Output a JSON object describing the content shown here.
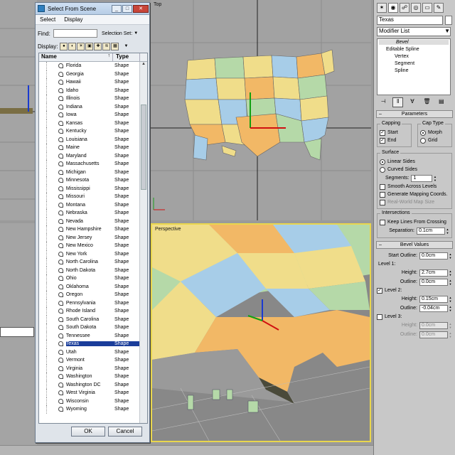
{
  "dialog": {
    "title": "Select From Scene",
    "menus": [
      "Select",
      "Display"
    ],
    "find_label": "Find:",
    "find_value": "",
    "selection_set_label": "Selection Set:",
    "display_label": "Display:",
    "columns": {
      "name": "Name",
      "type": "Type",
      "sort_indicator": "↑"
    },
    "rows": [
      {
        "name": "Florida",
        "type": "Shape"
      },
      {
        "name": "Georgia",
        "type": "Shape"
      },
      {
        "name": "Hawaii",
        "type": "Shape"
      },
      {
        "name": "Idaho",
        "type": "Shape"
      },
      {
        "name": "Illinois",
        "type": "Shape"
      },
      {
        "name": "Indiana",
        "type": "Shape"
      },
      {
        "name": "Iowa",
        "type": "Shape"
      },
      {
        "name": "Kansas",
        "type": "Shape"
      },
      {
        "name": "Kentucky",
        "type": "Shape"
      },
      {
        "name": "Louisiana",
        "type": "Shape"
      },
      {
        "name": "Maine",
        "type": "Shape"
      },
      {
        "name": "Maryland",
        "type": "Shape"
      },
      {
        "name": "Massachusetts",
        "type": "Shape"
      },
      {
        "name": "Michigan",
        "type": "Shape"
      },
      {
        "name": "Minnesota",
        "type": "Shape"
      },
      {
        "name": "Mississippi",
        "type": "Shape"
      },
      {
        "name": "Missouri",
        "type": "Shape"
      },
      {
        "name": "Montana",
        "type": "Shape"
      },
      {
        "name": "Nebraska",
        "type": "Shape"
      },
      {
        "name": "Nevada",
        "type": "Shape"
      },
      {
        "name": "New Hampshire",
        "type": "Shape"
      },
      {
        "name": "New Jersey",
        "type": "Shape"
      },
      {
        "name": "New Mexico",
        "type": "Shape"
      },
      {
        "name": "New York",
        "type": "Shape"
      },
      {
        "name": "North Carolina",
        "type": "Shape"
      },
      {
        "name": "North Dakota",
        "type": "Shape"
      },
      {
        "name": "Ohio",
        "type": "Shape"
      },
      {
        "name": "Oklahoma",
        "type": "Shape"
      },
      {
        "name": "Oregon",
        "type": "Shape"
      },
      {
        "name": "Pennsylvania",
        "type": "Shape"
      },
      {
        "name": "Rhode Island",
        "type": "Shape"
      },
      {
        "name": "South Carolina",
        "type": "Shape"
      },
      {
        "name": "South Dakota",
        "type": "Shape"
      },
      {
        "name": "Tennessee",
        "type": "Shape"
      },
      {
        "name": "Texas",
        "type": "Shape",
        "selected": true
      },
      {
        "name": "Utah",
        "type": "Shape"
      },
      {
        "name": "Vermont",
        "type": "Shape"
      },
      {
        "name": "Virginia",
        "type": "Shape"
      },
      {
        "name": "Washington",
        "type": "Shape"
      },
      {
        "name": "Washington DC",
        "type": "Shape"
      },
      {
        "name": "West Virginia",
        "type": "Shape"
      },
      {
        "name": "Wisconsin",
        "type": "Shape"
      },
      {
        "name": "Wyoming",
        "type": "Shape"
      }
    ],
    "ok_label": "OK",
    "cancel_label": "Cancel"
  },
  "viewports": {
    "top_label": "Top",
    "perspective_label": "Perspective"
  },
  "panel": {
    "object_name": "Texas",
    "modifier_list": "Modifier List",
    "stack": {
      "bevel": "Bevel",
      "editable_spline": "Editable Spline",
      "vertex": "Vertex",
      "segment": "Segment",
      "spline": "Spline"
    },
    "parameters": {
      "title": "Parameters",
      "capping_title": "Capping",
      "cap_start": "Start",
      "cap_end": "End",
      "cap_type_title": "Cap Type",
      "morph": "Morph",
      "grid": "Grid",
      "surface_title": "Surface",
      "linear_sides": "Linear Sides",
      "curved_sides": "Curved Sides",
      "segments_label": "Segments:",
      "segments_value": "1",
      "smooth_across": "Smooth Across Levels",
      "gen_mapping": "Generate Mapping Coords.",
      "real_world": "Real-World Map Size",
      "intersections_title": "Intersections",
      "keep_lines": "Keep Lines From Crossing",
      "separation_label": "Separation:",
      "separation_value": "0.1cm"
    },
    "bevel_values": {
      "title": "Bevel Values",
      "start_outline_label": "Start Outline:",
      "start_outline_value": "0.0cm",
      "level1": "Level 1:",
      "level1_height": "2.7cm",
      "level1_outline": "0.0cm",
      "level2": "Level 2:",
      "level2_height": "0.15cm",
      "level2_outline": "-0.04cm",
      "level3": "Level 3:",
      "level3_height": "0.0cm",
      "level3_outline": "0.0cm",
      "height_label": "Height:",
      "outline_label": "Outline:"
    }
  },
  "colors": {
    "state_yellow": "#f0dd8a",
    "state_blue": "#a7cde8",
    "state_green": "#b5d9a8",
    "state_orange": "#f2b866",
    "selection": "#1a3d9a"
  }
}
